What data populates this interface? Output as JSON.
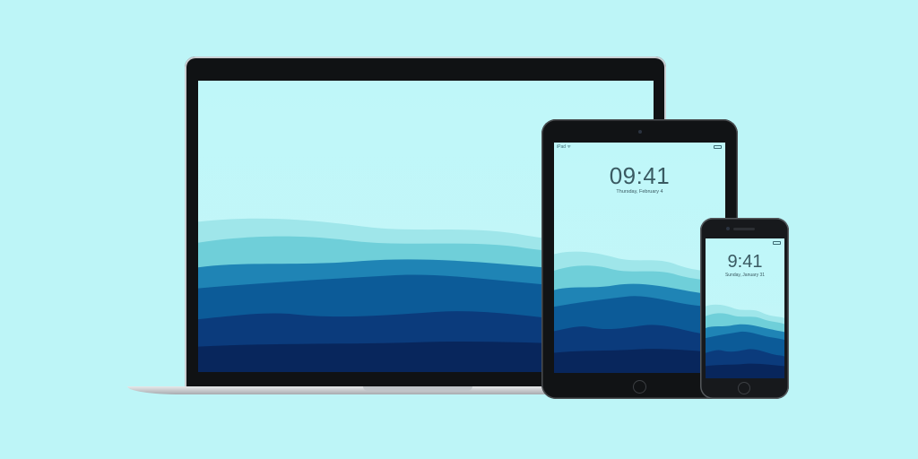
{
  "colors": {
    "background": "#bdf5f7",
    "sky": "#bff6f8",
    "mountain_front": "#0a2a62",
    "device_frame": "#101214"
  },
  "ipad": {
    "status_left": "iPad ᯤ",
    "time": "09:41",
    "date": "Thursday, February 4"
  },
  "iphone": {
    "time": "9:41",
    "date": "Sunday, January 31"
  }
}
